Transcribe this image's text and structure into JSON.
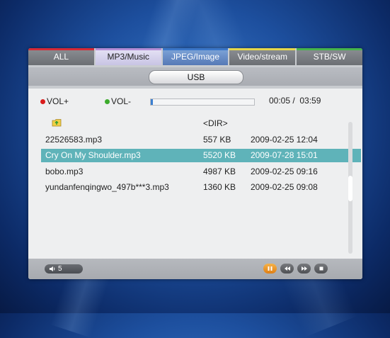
{
  "tabs": [
    {
      "label": "ALL",
      "accent": "#d62a36"
    },
    {
      "label": "MP3/Music",
      "accent": "#b48ed6"
    },
    {
      "label": "JPEG/Image",
      "accent": "#3a76c8"
    },
    {
      "label": "Video/stream",
      "accent": "#e7d84a"
    },
    {
      "label": "STB/SW",
      "accent": "#46b54b"
    }
  ],
  "active_tab": "MP3/Music",
  "source": "USB",
  "controls": {
    "vol_up": "VOL+",
    "vol_down": "VOL-",
    "time": "00:05 /  03:59",
    "progress_fraction": 0.02
  },
  "files": [
    {
      "name": "",
      "size": "<DIR>",
      "date": "",
      "icon": "folder-up-icon"
    },
    {
      "name": "22526583.mp3",
      "size": "557 KB",
      "date": "2009-02-25 12:04"
    },
    {
      "name": "Cry On My Shoulder.mp3",
      "size": "5520 KB",
      "date": "2009-07-28 15:01",
      "selected": true
    },
    {
      "name": "bobo.mp3",
      "size": "4987 KB",
      "date": "2009-02-25 09:16"
    },
    {
      "name": "yundanfenqingwo_497b***3.mp3",
      "size": "1360 KB",
      "date": "2009-02-25 09:08"
    }
  ],
  "status": {
    "volume": "5",
    "buttons": [
      "pause-icon",
      "rewind-icon",
      "fast-forward-icon",
      "stop-icon"
    ]
  },
  "colors": {
    "selected_row": "#5fb3b9",
    "progress_fill": "#3b7fd1"
  }
}
